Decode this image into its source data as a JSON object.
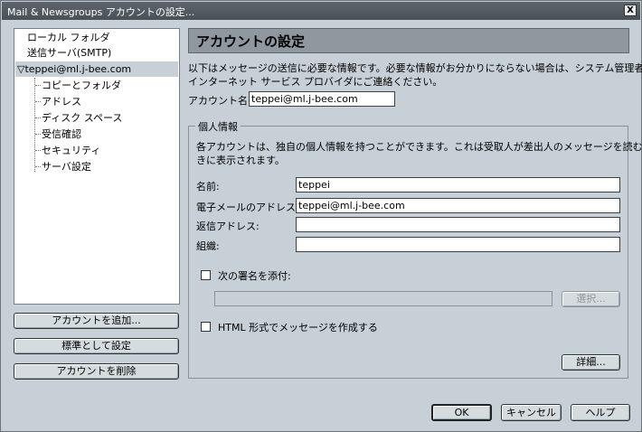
{
  "window": {
    "title": "Mail & Newsgroups アカウントの設定...",
    "close_glyph": "X"
  },
  "tree": {
    "items": [
      {
        "label": "ローカル フォルダ"
      },
      {
        "label": "送信サーバ(SMTP)"
      },
      {
        "label": "teppei@ml.j-bee.com",
        "expander": "▽"
      },
      {
        "label": "コピーとフォルダ"
      },
      {
        "label": "アドレス"
      },
      {
        "label": "ディスク スペース"
      },
      {
        "label": "受信確認"
      },
      {
        "label": "セキュリティ"
      },
      {
        "label": "サーバ設定"
      }
    ]
  },
  "left_buttons": {
    "add": "アカウントを追加...",
    "default": "標準として設定",
    "remove": "アカウントを削除"
  },
  "panel": {
    "title": "アカウントの設定",
    "description_1": "以下はメッセージの送信に必要な情報です。必要な情報がお分かりにならない場合は、システム管理者か",
    "description_2": "インターネット サービス プロバイダにご連絡ください。",
    "account_name_label": "アカウント名:",
    "account_name_value": "teppei@ml.j-bee.com"
  },
  "identity": {
    "legend": "個人情報",
    "desc_1": "各アカウントは、独自の個人情報を持つことができます。これは受取人が差出人のメッセージを読むと",
    "desc_2": "きに表示されます。",
    "name_label": "名前:",
    "name_value": "teppei",
    "email_label": "電子メールのアドレス:",
    "email_value": "teppei@ml.j-bee.com",
    "reply_label": "返信アドレス:",
    "reply_value": "",
    "org_label": "組織:",
    "org_value": "",
    "signature_label": "次の署名を添付:",
    "signature_path": "",
    "choose_button": "選択...",
    "html_label": "HTML 形式でメッセージを作成する",
    "advanced_button": "詳細..."
  },
  "footer": {
    "ok": "OK",
    "cancel": "キャンセル",
    "help": "ヘルプ"
  }
}
